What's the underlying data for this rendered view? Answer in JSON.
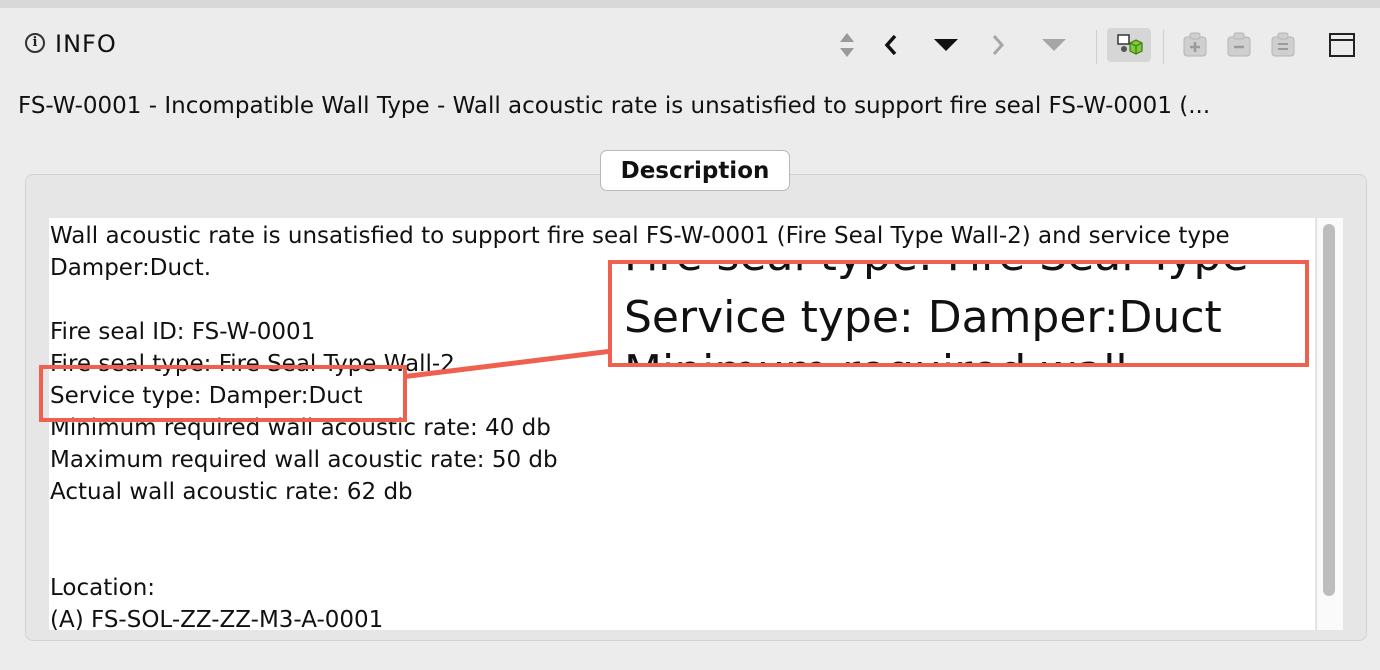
{
  "panel": {
    "title": "INFO",
    "info_icon_glyph": "i"
  },
  "toolbar": {
    "icons": [
      "up-down-arrows-icon",
      "chevron-left-icon",
      "triangle-down-icon",
      "chevron-right-icon",
      "triangle-down-disabled-icon",
      "rule-cube-icon",
      "add-issue-icon",
      "remove-issue-icon",
      "list-issue-icon",
      "maximize-window-icon"
    ]
  },
  "issue": {
    "headline": "FS-W-0001 - Incompatible Wall Type - Wall acoustic rate is unsatisfied to support fire seal FS-W-0001 (..."
  },
  "description": {
    "tab_label": "Description",
    "paragraph": "Wall acoustic rate is unsatisfied to support fire seal FS-W-0001 (Fire Seal Type Wall-2) and service type Damper:Duct.",
    "lines": {
      "fire_seal_id": "Fire seal ID: FS-W-0001",
      "fire_seal_type": "Fire seal type: Fire Seal Type Wall-2",
      "service_type": "Service type: Damper:Duct",
      "min_rate": "Minimum required wall acoustic rate: 40 db",
      "max_rate": "Maximum required wall acoustic rate: 50 db",
      "actual_rate": "Actual wall acoustic rate: 62 db",
      "location_label": "Location:",
      "location_value": "(A) FS-SOL-ZZ-ZZ-M3-A-0001"
    }
  },
  "callout": {
    "zoom_text": "Service type: Damper:Duct",
    "zoom_above": "Fire seal type: Fire Seal Type",
    "zoom_below": "Minimum required wall",
    "color": "#f0604f"
  }
}
